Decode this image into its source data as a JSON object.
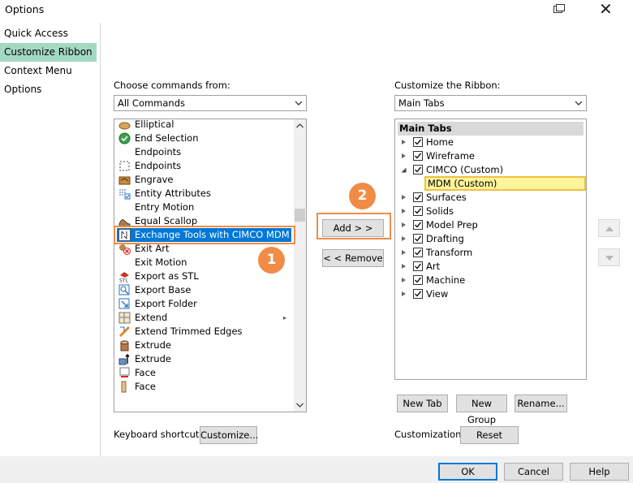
{
  "window": {
    "title": "Options",
    "close_glyph": "✕"
  },
  "nav": {
    "items": [
      {
        "label": "Quick Access Toolbar",
        "selected": false
      },
      {
        "label": "Customize Ribbon",
        "selected": true
      },
      {
        "label": "Context Menu",
        "selected": false
      },
      {
        "label": "Options",
        "selected": false
      }
    ]
  },
  "left": {
    "choose_label": "Choose commands from:",
    "choose_value": "All Commands",
    "commands": [
      {
        "label": "Elliptical",
        "icon": "elliptical-icon"
      },
      {
        "label": "End Selection",
        "icon": "check-circle-icon"
      },
      {
        "label": "Endpoints",
        "icon": ""
      },
      {
        "label": "Endpoints",
        "icon": "endpoints-icon"
      },
      {
        "label": "Engrave",
        "icon": "engrave-icon"
      },
      {
        "label": "Entity Attributes",
        "icon": "entity-attributes-icon"
      },
      {
        "label": "Entry Motion",
        "icon": ""
      },
      {
        "label": "Equal Scallop",
        "icon": "equal-scallop-icon"
      },
      {
        "label": "Exchange Tools with CIMCO MDM",
        "icon": "exchange-tools-icon",
        "selected": true
      },
      {
        "label": "Exit Art",
        "icon": "exit-art-icon"
      },
      {
        "label": "Exit Motion",
        "icon": ""
      },
      {
        "label": "Export as STL",
        "icon": "export-stl-icon"
      },
      {
        "label": "Export Base",
        "icon": "export-base-icon"
      },
      {
        "label": "Export Folder",
        "icon": "export-folder-icon"
      },
      {
        "label": "Extend",
        "icon": "extend-icon",
        "submenu": true
      },
      {
        "label": "Extend Trimmed Edges",
        "icon": "extend-trimmed-icon"
      },
      {
        "label": "Extrude",
        "icon": "extrude-icon"
      },
      {
        "label": "Extrude",
        "icon": "extrude-arrow-icon"
      },
      {
        "label": "Face",
        "icon": "face-icon"
      },
      {
        "label": "Face",
        "icon": "face-plate-icon"
      }
    ],
    "keyboard_label": "Keyboard shortcuts:",
    "customize_btn": "Customize..."
  },
  "middle": {
    "add_btn": "Add > >",
    "remove_btn": "< < Remove",
    "callout_1": "1",
    "callout_2": "2"
  },
  "right": {
    "customize_label": "Customize the Ribbon:",
    "customize_value": "Main Tabs",
    "tree_header": "Main Tabs",
    "tabs": [
      {
        "label": "Home",
        "checked": true,
        "expanded": false
      },
      {
        "label": "Wireframe",
        "checked": true,
        "expanded": false
      },
      {
        "label": "CIMCO (Custom)",
        "checked": true,
        "expanded": true
      },
      {
        "label": "Surfaces",
        "checked": true,
        "expanded": false
      },
      {
        "label": "Solids",
        "checked": true,
        "expanded": false
      },
      {
        "label": "Model Prep",
        "checked": true,
        "expanded": false
      },
      {
        "label": "Drafting",
        "checked": true,
        "expanded": false
      },
      {
        "label": "Transform",
        "checked": true,
        "expanded": false
      },
      {
        "label": "Art",
        "checked": true,
        "expanded": false
      },
      {
        "label": "Machine",
        "checked": true,
        "expanded": false
      },
      {
        "label": "View",
        "checked": true,
        "expanded": false
      }
    ],
    "child_item": "MDM (Custom)",
    "new_tab_btn": "New Tab",
    "new_group_btn": "New Group",
    "rename_btn": "Rename...",
    "customizations_label": "Customizations:",
    "reset_btn": "Reset"
  },
  "footer": {
    "ok": "OK",
    "cancel": "Cancel",
    "help": "Help"
  },
  "colors": {
    "accent": "#0078d7",
    "nav_selected": "#a3d9c3",
    "callout": "#f08c45",
    "highlight": "#fff49c"
  }
}
